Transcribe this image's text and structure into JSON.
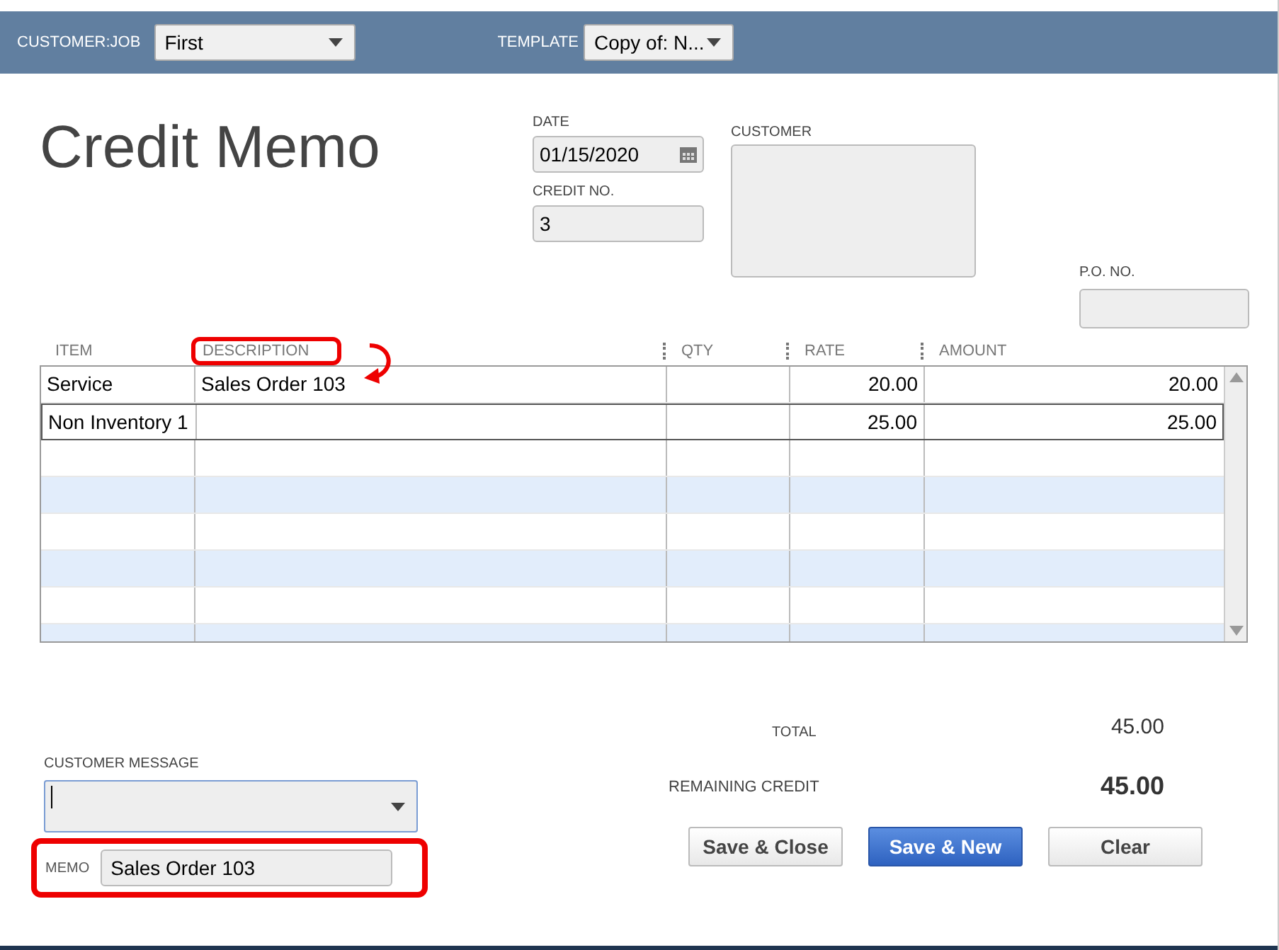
{
  "header": {
    "customer_job": {
      "label": "CUSTOMER:JOB",
      "value": "First"
    },
    "template": {
      "label": "TEMPLATE",
      "value": "Copy of: N..."
    }
  },
  "title": "Credit Memo",
  "date": {
    "label": "DATE",
    "value": "01/15/2020"
  },
  "credit_no": {
    "label": "CREDIT NO.",
    "value": "3"
  },
  "customer": {
    "label": "CUSTOMER"
  },
  "po_no": {
    "label": "P.O. NO."
  },
  "table": {
    "columns": [
      {
        "label": "ITEM",
        "highlighted": false
      },
      {
        "label": "DESCRIPTION",
        "highlighted": true
      },
      {
        "label": "QTY",
        "highlighted": false
      },
      {
        "label": "RATE",
        "highlighted": false
      },
      {
        "label": "AMOUNT",
        "highlighted": false
      }
    ],
    "rows": [
      {
        "item": "Service",
        "description": "Sales Order 103",
        "rate": "20.00",
        "amount": "20.00",
        "selected": false
      },
      {
        "item": "Non Inventory 1",
        "rate": "25.00",
        "amount": "25.00",
        "selected": true
      }
    ]
  },
  "total": {
    "label": "TOTAL",
    "value": "45.00"
  },
  "customer_message": {
    "label": "CUSTOMER MESSAGE"
  },
  "remaining_credit": {
    "label": "REMAINING CREDIT",
    "value": "45.00"
  },
  "memo": {
    "label": "MEMO",
    "value": "Sales Order 103",
    "highlighted": true
  },
  "buttons": [
    {
      "label": "Save & Close",
      "kind": "default"
    },
    {
      "label": "Save & New",
      "kind": "primary"
    },
    {
      "label": "Clear",
      "kind": "default"
    }
  ]
}
